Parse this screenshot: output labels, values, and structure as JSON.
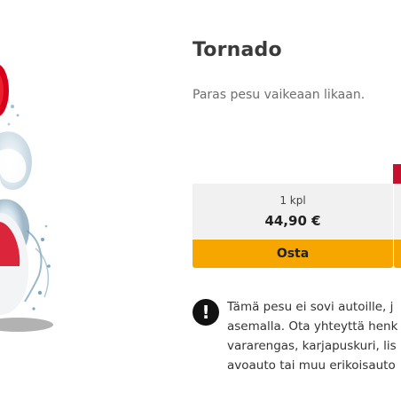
{
  "product": {
    "title": "Tornado",
    "subtitle": "Paras pesu vaikeaan likaan.",
    "image_icon": "product-wash-splash-image"
  },
  "pricing": {
    "options": [
      {
        "quantity_label": "1 kpl",
        "price": "44,90 €",
        "buy_label": "Osta"
      }
    ]
  },
  "notice": {
    "icon": "exclamation-icon",
    "lines": [
      "Tämä pesu ei sovi autoille, j",
      "asemalla. Ota yhteyttä henk",
      "vararengas, karjapuskuri, lis",
      "avoauto tai muu erikoisauto"
    ]
  },
  "colors": {
    "buy_button": "#f7a600",
    "price_card_bg": "#f1f1f1",
    "ribbon": "#c8102e",
    "title": "#3a3a3a",
    "subtitle": "#6e6e6e"
  }
}
